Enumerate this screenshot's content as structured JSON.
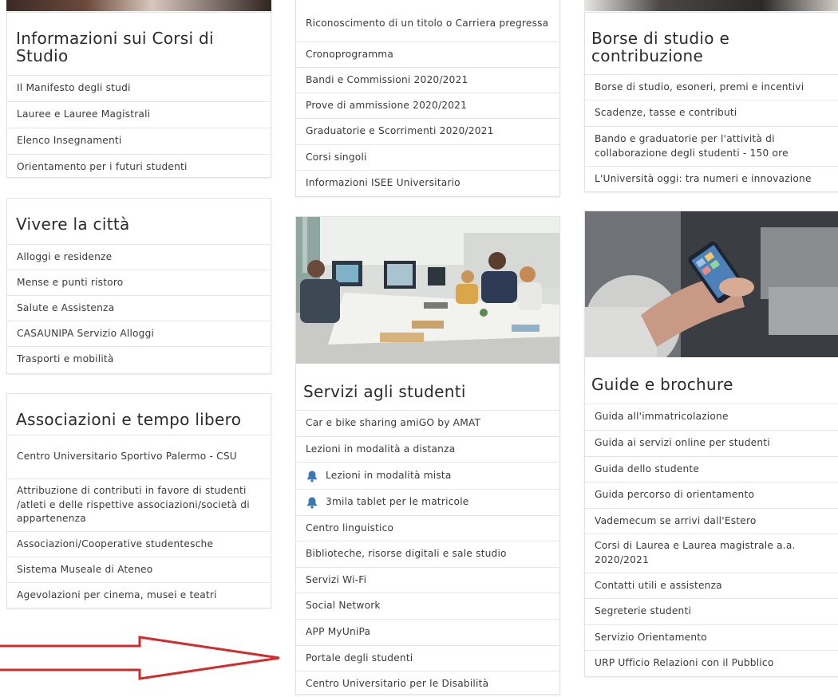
{
  "col1": {
    "corsi": {
      "title": "Informazioni sui Corsi di Studio",
      "items": [
        "Il Manifesto degli studi",
        "Lauree e Lauree Magistrali",
        "Elenco Insegnamenti",
        "Orientamento per i futuri studenti"
      ]
    },
    "citta": {
      "title": "Vivere la città",
      "items": [
        "Alloggi e residenze",
        "Mense e punti ristoro",
        "Salute e Assistenza",
        "CASAUNIPA Servizio Alloggi",
        "Trasporti e mobilità"
      ]
    },
    "associazioni": {
      "title": "Associazioni e tempo libero",
      "items": [
        "Centro Universitario Sportivo Palermo - CSU",
        "Attribuzione di contributi in favore di studenti /atleti e delle rispettive associazioni/società di appartenenza",
        "Associazioni/Cooperative studentesche",
        "Sistema Museale di Ateneo",
        "Agevolazioni per cinema, musei e teatri"
      ]
    }
  },
  "col2": {
    "top_items": [
      "Riconoscimento di un titolo o Carriera pregressa",
      "Cronoprogramma",
      "Bandi e Commissioni 2020/2021",
      "Prove di ammissione 2020/2021",
      "Graduatorie e Scorrimenti 2020/2021",
      "Corsi singoli",
      "Informazioni ISEE Universitario"
    ],
    "servizi": {
      "title": "Servizi agli studenti",
      "items": [
        "Car e bike sharing amiGO by AMAT",
        "Lezioni in modalità a distanza",
        "Lezioni in modalità mista",
        "3mila tablet per le matricole",
        "Centro linguistico",
        "Biblioteche, risorse digitali e sale studio",
        "Servizi Wi-Fi",
        "Social Network",
        "APP MyUniPa",
        "Portale degli studenti",
        "Centro Universitario per le Disabilità"
      ]
    }
  },
  "col3": {
    "borse": {
      "title": "Borse di studio e contribuzione",
      "items": [
        "Borse di studio, esoneri, premi e incentivi",
        "Scadenze, tasse e contributi",
        "Bando e graduatorie per l'attività di collaborazione degli studenti - 150 ore",
        "L'Università oggi: tra numeri e innovazione"
      ]
    },
    "guide": {
      "title": "Guide e brochure",
      "items": [
        "Guida all'immatricolazione",
        "Guida ai servizi online per studenti",
        "Guida dello studente",
        "Guida percorso di orientamento",
        "Vademecum se arrivi dall'Estero",
        "Corsi di Laurea e Laurea magistrale a.a. 2020/2021",
        "Contatti utili e assistenza",
        "Segreterie studenti",
        "Servizio Orientamento",
        "URP Ufficio Relazioni con il Pubblico"
      ]
    }
  },
  "colors": {
    "arrow": "#d42a2a",
    "bell": "#3c78b5",
    "border": "#e6e6e6"
  },
  "icons": {
    "bell": "bell-icon",
    "arrow": "red-arrow-annotation"
  }
}
